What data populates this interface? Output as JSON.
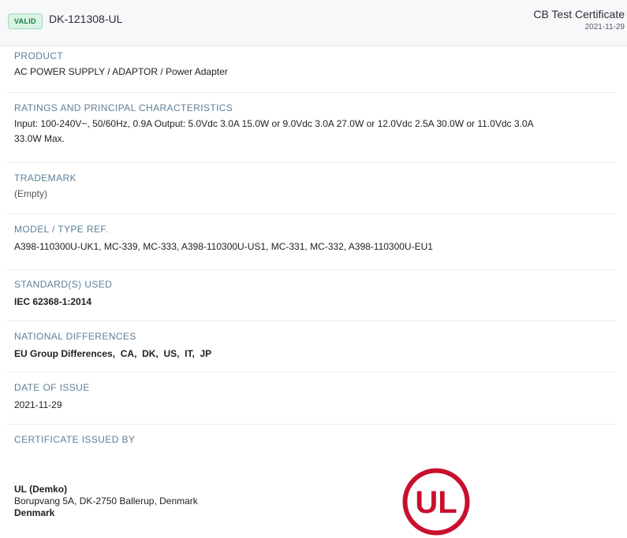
{
  "header": {
    "status_badge": "VALID",
    "certificate_id": "DK-121308-UL",
    "certificate_type": "CB Test Certificate",
    "date": "2021-11-29"
  },
  "sections": {
    "product": {
      "label": "PRODUCT",
      "value": "AC POWER SUPPLY / ADAPTOR / Power Adapter"
    },
    "ratings": {
      "label": "RATINGS AND PRINCIPAL CHARACTERISTICS",
      "line1": "Input: 100-240V~, 50/60Hz, 0.9A Output: 5.0Vdc 3.0A 15.0W or 9.0Vdc 3.0A 27.0W or 12.0Vdc 2.5A 30.0W or 11.0Vdc 3.0A",
      "line2": "33.0W Max."
    },
    "trademark": {
      "label": "TRADEMARK",
      "value": "(Empty)"
    },
    "model": {
      "label": "MODEL / TYPE REF.",
      "value": "A398-110300U-UK1, MC-339, MC-333, A398-110300U-US1, MC-331, MC-332, A398-110300U-EU1"
    },
    "standards": {
      "label": "STANDARD(S) USED",
      "value": "IEC 62368-1:2014"
    },
    "national_differences": {
      "label": "NATIONAL DIFFERENCES",
      "items": [
        "EU Group Differences",
        "CA",
        "DK",
        "US",
        "IT",
        "JP"
      ]
    },
    "date_of_issue": {
      "label": "DATE OF ISSUE",
      "value": "2021-11-29"
    },
    "issued_by": {
      "label": "CERTIFICATE ISSUED BY",
      "name": "UL (Demko)",
      "address": "Borupvang 5A, DK-2750 Ballerup, Denmark",
      "country": "Denmark",
      "logo_text": "UL"
    }
  },
  "colors": {
    "badge_bg": "#d9f4e5",
    "badge_text": "#1b7a43",
    "label": "#5e7f95",
    "ul_red": "#c8102e"
  }
}
